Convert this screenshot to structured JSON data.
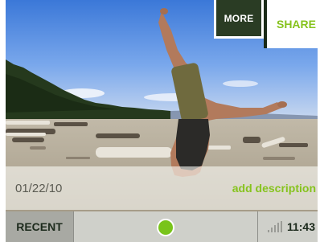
{
  "menu": {
    "more_label": "MORE",
    "share_label": "SHARE"
  },
  "photo": {
    "date": "01/22/10",
    "add_description_label": "add description"
  },
  "bottom_bar": {
    "recent_label": "RECENT",
    "home_icon": "green-dot-icon",
    "signal_icon": "signal-strength-icon",
    "time": "11:43"
  },
  "colors": {
    "accent": "#86c31d",
    "menu_dark": "#2a3c24",
    "bar_gray": "#cfd0ca"
  }
}
